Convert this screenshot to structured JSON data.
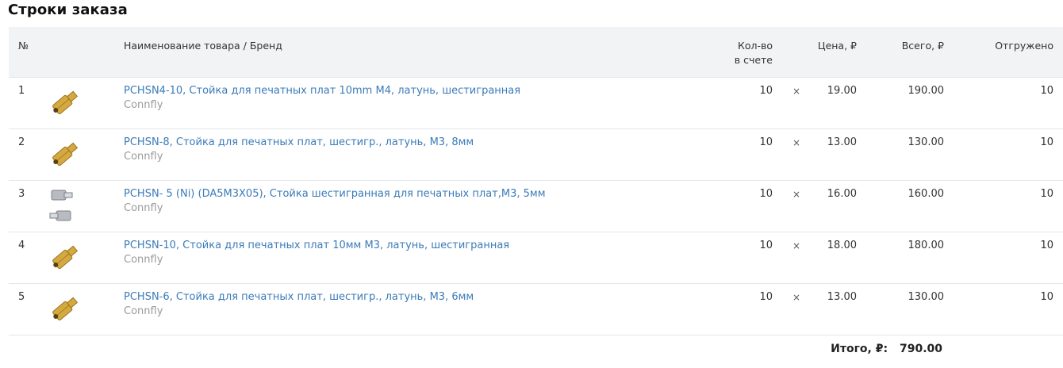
{
  "title": "Строки заказа",
  "header": {
    "num": "№",
    "name": "Наименование товара / Бренд",
    "qty_line1": "Кол-во",
    "qty_line2": "в счете",
    "price": "Цена, ₽",
    "total": "Всего, ₽",
    "shipped": "Отгружено"
  },
  "rows": [
    {
      "num": "1",
      "name": "PCHSN4-10, Стойка для печатных плат 10mm M4, латунь, шестигранная",
      "brand": "Connfly",
      "qty": "10",
      "times": "×",
      "price": "19.00",
      "total": "190.00",
      "shipped": "10",
      "image": "brass-standoff-image"
    },
    {
      "num": "2",
      "name": "PCHSN-8, Стойка для печатных плат, шестигр., латунь, М3, 8мм",
      "brand": "Connfly",
      "qty": "10",
      "times": "×",
      "price": "13.00",
      "total": "130.00",
      "shipped": "10",
      "image": "brass-standoff-image"
    },
    {
      "num": "3",
      "name": "PCHSN- 5 (Ni) (DA5M3X05), Стойка шестигранная для печатных плат,M3, 5мм",
      "brand": "Connfly",
      "qty": "10",
      "times": "×",
      "price": "16.00",
      "total": "160.00",
      "shipped": "10",
      "image": "nickel-standoff-image"
    },
    {
      "num": "4",
      "name": "PCHSN-10, Стойка для печатных плат 10мм М3, латунь, шестигранная",
      "brand": "Connfly",
      "qty": "10",
      "times": "×",
      "price": "18.00",
      "total": "180.00",
      "shipped": "10",
      "image": "brass-standoff-image"
    },
    {
      "num": "5",
      "name": "PCHSN-6, Стойка для печатных плат, шестигр., латунь, М3, 6мм",
      "brand": "Connfly",
      "qty": "10",
      "times": "×",
      "price": "13.00",
      "total": "130.00",
      "shipped": "10",
      "image": "brass-standoff-image"
    }
  ],
  "summary": {
    "label": "Итого, ₽:",
    "value": "790.00"
  },
  "colors": {
    "link": "#3b7bb8",
    "brand": "#9a9a9a",
    "header_bg": "#f2f3f5",
    "brass": "#d4a940",
    "nickel": "#b8bcc2"
  }
}
